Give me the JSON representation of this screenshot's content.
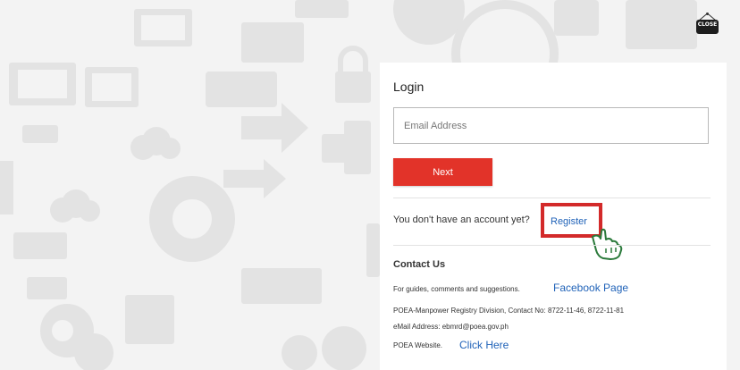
{
  "close": {
    "label": "CLOSE",
    "icon": "close-sign-icon"
  },
  "login": {
    "title": "Login",
    "email_placeholder": "Email Address",
    "next_label": "Next"
  },
  "register": {
    "prompt": "You don't have an account yet?",
    "link_label": "Register",
    "highlight_color": "#d32a2a",
    "cursor_icon": "hand-pointer-icon"
  },
  "contact": {
    "title": "Contact Us",
    "guides_text": "For guides, comments and suggestions.",
    "facebook_label": "Facebook Page",
    "division_text": "POEA-Manpower Registry Division, Contact No: 8722-11-46, 8722-11-81",
    "email_text": "eMail Address: ebmrd@poea.gov.ph",
    "website_text": "POEA Website.",
    "website_link": "Click Here"
  },
  "colors": {
    "accent": "#e23329",
    "link": "#1f62b8"
  }
}
